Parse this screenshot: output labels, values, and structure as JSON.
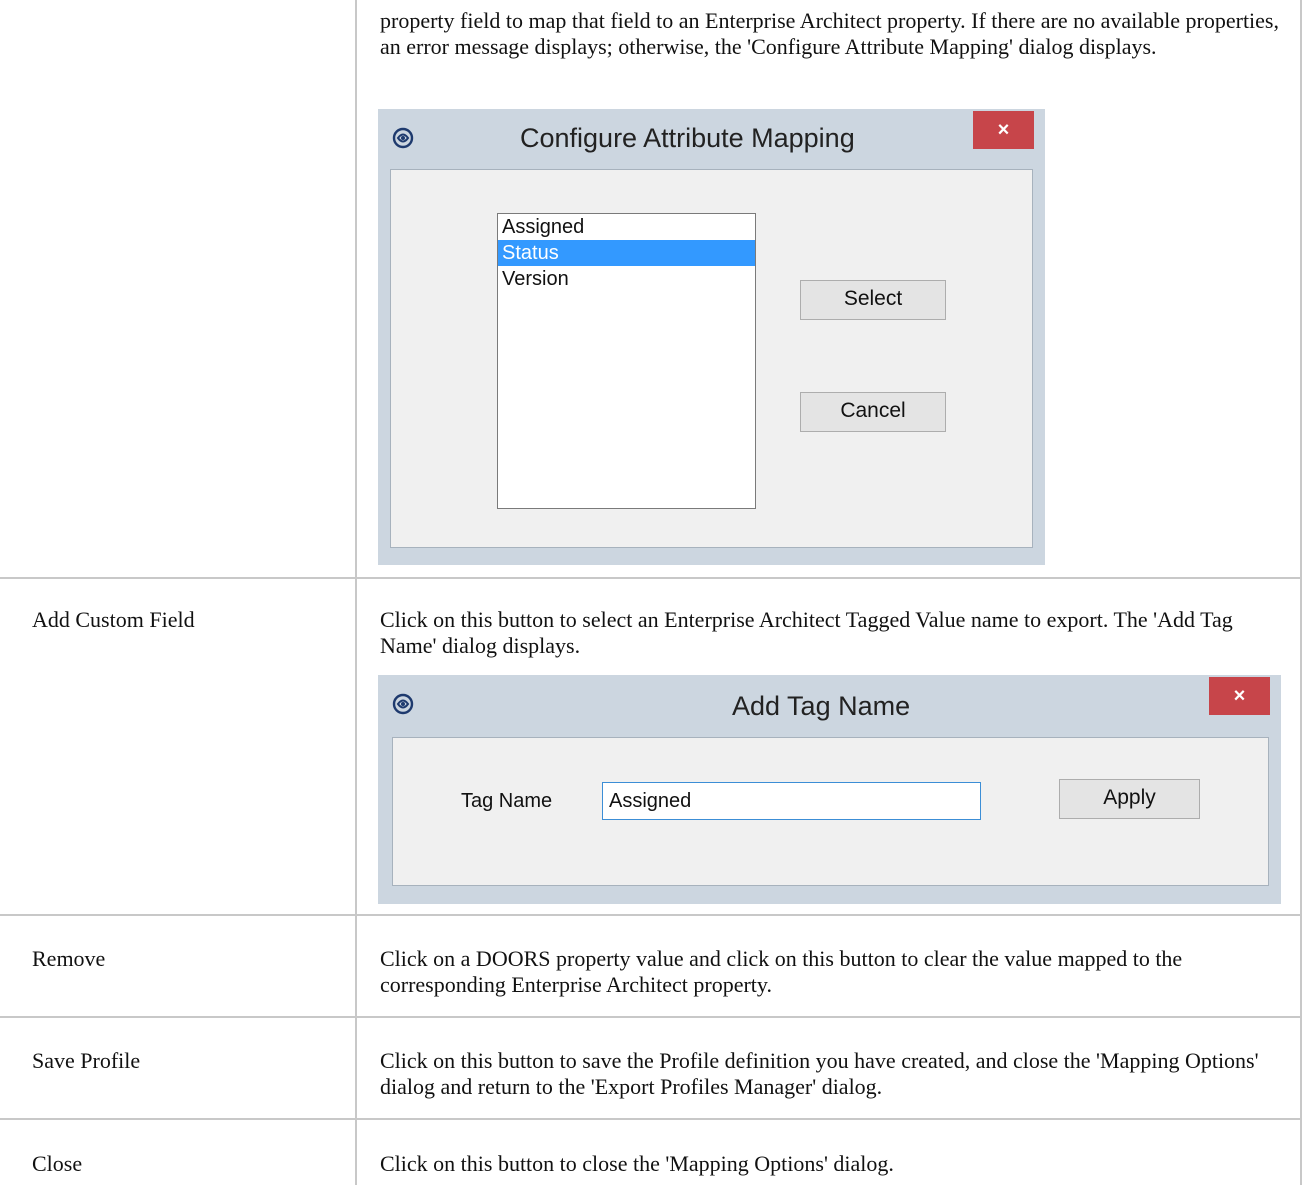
{
  "rows": [
    {
      "label": "",
      "description": "property field to map that field to an Enterprise Architect property. If there are no available properties, an error message displays; otherwise, the 'Configure Attribute Mapping' dialog displays.",
      "dialog": {
        "title": "Configure Attribute Mapping",
        "close_glyph": "×",
        "list_items": [
          "Assigned",
          "Status",
          "Version"
        ],
        "selected_item": "Status",
        "select_button": "Select",
        "cancel_button": "Cancel"
      }
    },
    {
      "label": "Add Custom Field",
      "description": "Click on this button to select an Enterprise Architect Tagged Value name to export. The 'Add Tag Name' dialog displays.",
      "dialog": {
        "title": "Add Tag Name",
        "close_glyph": "×",
        "field_label": "Tag Name",
        "field_value": "Assigned",
        "apply_button": "Apply"
      }
    },
    {
      "label": "Remove",
      "description": "Click on a DOORS property value and click on this button to clear the value mapped to the corresponding Enterprise Architect property."
    },
    {
      "label": "Save Profile",
      "description": "Click on this button to save the Profile definition you have created, and close the 'Mapping Options' dialog and return to the 'Export Profiles Manager' dialog."
    },
    {
      "label": "Close",
      "description": "Click on this button to close the 'Mapping Options' dialog."
    }
  ],
  "colors": {
    "grid": "#c8c8c8",
    "dialog_frame": "#ccd6e0",
    "close_button": "#c7454a",
    "selection": "#3399ff"
  }
}
